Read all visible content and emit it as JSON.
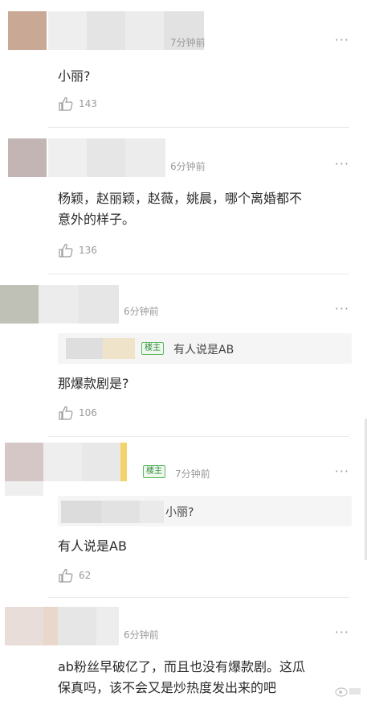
{
  "comments": [
    {
      "time": "7分钟前",
      "text": "小丽?",
      "likes": "143"
    },
    {
      "time": "6分钟前",
      "text_line1": "杨颖，赵丽颖，赵薇，姚晨，哪个离婚都不",
      "text_line2": "意外的样子。",
      "likes": "136"
    },
    {
      "time": "6分钟前",
      "badge": "楼主",
      "quote": "有人说是AB",
      "text": "那爆款剧是?",
      "likes": "106"
    },
    {
      "badge": "楼主",
      "time": "7分钟前",
      "quote": "小丽?",
      "text": "有人说是AB",
      "likes": "62"
    },
    {
      "time": "6分钟前",
      "text_line1": "ab粉丝早破亿了，而且也没有爆款剧。这瓜",
      "text_line2": "保真吗，该不会又是炒热度发出来的吧"
    }
  ],
  "more_glyph": "···",
  "icons": {
    "like": "thumbs-up-icon",
    "more": "more-dots-icon",
    "watermark": "weibo-watermark-icon"
  },
  "colors": {
    "badge_green": "#2e8b3a",
    "muted": "#9a9a9a"
  }
}
